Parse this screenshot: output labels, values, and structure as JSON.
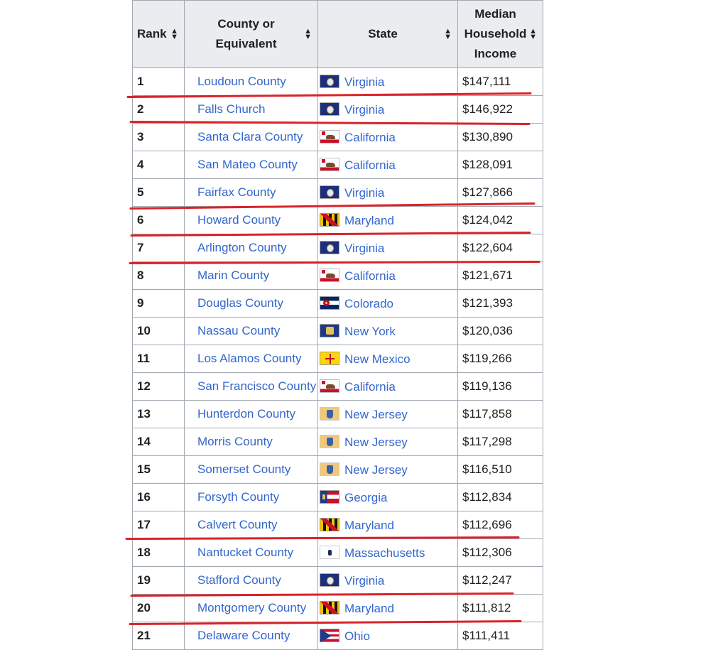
{
  "table": {
    "headers": {
      "rank": "Rank",
      "county_line1": "County or",
      "county_line2": "Equivalent",
      "state": "State",
      "income_line1": "Median",
      "income_line2": "Household",
      "income_line3": "Income"
    },
    "rows": [
      {
        "rank": "1",
        "county": "Loudoun County",
        "state": "Virginia",
        "income": "$147,111"
      },
      {
        "rank": "2",
        "county": "Falls Church",
        "state": "Virginia",
        "income": "$146,922"
      },
      {
        "rank": "3",
        "county": "Santa Clara County",
        "state": "California",
        "income": "$130,890"
      },
      {
        "rank": "4",
        "county": "San Mateo County",
        "state": "California",
        "income": "$128,091"
      },
      {
        "rank": "5",
        "county": "Fairfax County",
        "state": "Virginia",
        "income": "$127,866"
      },
      {
        "rank": "6",
        "county": "Howard County",
        "state": "Maryland",
        "income": "$124,042"
      },
      {
        "rank": "7",
        "county": "Arlington County",
        "state": "Virginia",
        "income": "$122,604"
      },
      {
        "rank": "8",
        "county": "Marin County",
        "state": "California",
        "income": "$121,671"
      },
      {
        "rank": "9",
        "county": "Douglas County",
        "state": "Colorado",
        "income": "$121,393"
      },
      {
        "rank": "10",
        "county": "Nassau County",
        "state": "New York",
        "income": "$120,036"
      },
      {
        "rank": "11",
        "county": "Los Alamos County",
        "state": "New Mexico",
        "income": "$119,266"
      },
      {
        "rank": "12",
        "county": "San Francisco County",
        "state": "California",
        "income": "$119,136"
      },
      {
        "rank": "13",
        "county": "Hunterdon County",
        "state": "New Jersey",
        "income": "$117,858"
      },
      {
        "rank": "14",
        "county": "Morris County",
        "state": "New Jersey",
        "income": "$117,298"
      },
      {
        "rank": "15",
        "county": "Somerset County",
        "state": "New Jersey",
        "income": "$116,510"
      },
      {
        "rank": "16",
        "county": "Forsyth County",
        "state": "Georgia",
        "income": "$112,834"
      },
      {
        "rank": "17",
        "county": "Calvert County",
        "state": "Maryland",
        "income": "$112,696"
      },
      {
        "rank": "18",
        "county": "Nantucket County",
        "state": "Massachusetts",
        "income": "$112,306"
      },
      {
        "rank": "19",
        "county": "Stafford County",
        "state": "Virginia",
        "income": "$112,247"
      },
      {
        "rank": "20",
        "county": "Montgomery County",
        "state": "Maryland",
        "income": "$111,812"
      },
      {
        "rank": "21",
        "county": "Delaware County",
        "state": "Ohio",
        "income": "$111,411"
      }
    ]
  },
  "annotations": {
    "underline_color": "#d9232a",
    "underlined_ranks": [
      "1",
      "2",
      "5",
      "6",
      "7",
      "17",
      "19",
      "20"
    ]
  }
}
